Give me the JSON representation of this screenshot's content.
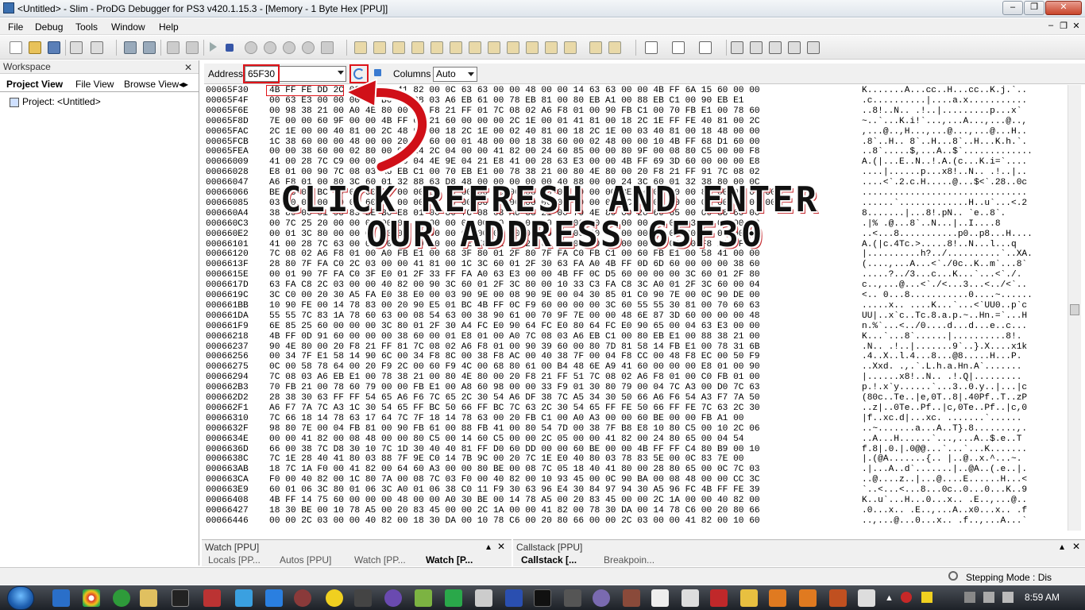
{
  "window": {
    "title": "<Untitled> - Slim - ProDG Debugger for PS3 v420.1.15.3 - [Memory - 1 Byte Hex [PPU]]"
  },
  "menu": [
    "File",
    "Debug",
    "Tools",
    "Window",
    "Help"
  ],
  "workspace": {
    "title": "Workspace",
    "tabs": [
      "Project View",
      "File View",
      "Browse View"
    ],
    "tree_item": "Project: <Untitled>"
  },
  "memory": {
    "address_label": "Address",
    "address_value": "65F30",
    "columns_label": "Columns",
    "columns_value": "Auto",
    "rows": [
      {
        "addr": "00065F30",
        "hex": "4B FF FE DD 2C 03 00 00 41 82 00 0C 63 63 00 00 48 00 00 14 63 63 00 00 4B FF 6A 15 60 00 00",
        "txt": "K.......A...cc..H...cc..K.j.`.."
      },
      {
        "addr": "00065F4F",
        "hex": "00 63 E3 00 00 00 00 B0 7C 08 03 A6 EB 61 00 78 EB 81 00 80 EB A1 00 88 EB C1 00 90 EB E1",
        "txt": ".c..........|....a.x..........."
      },
      {
        "addr": "00065F6E",
        "hex": "00 98 38 21 00 A0 4E 80 00 20 F8 21 FF 01 7C 08 02 A6 F8 01 00 90 FB C1 00 70 FB E1 00 78 60",
        "txt": "..8!..N.. .!..|.........p...x`"
      },
      {
        "addr": "00065F8D",
        "hex": "7E 00 00 60 9F 00 00 4B FF 69 21 60 00 00 00 2C 1E 00 01 41 81 00 18 2C 1E FF FE 40 81 00 2C",
        "txt": "~..`...K.i!`...,...A...,...@..,"
      },
      {
        "addr": "00065FAC",
        "hex": "2C 1E 00 00 40 81 00 2C 48 00 00 18 2C 1E 00 02 40 81 00 18 2C 1E 00 03 40 81 00 18 48 00 00",
        "txt": ",...@..,H...,...@...,...@...H.."
      },
      {
        "addr": "00065FCB",
        "hex": "1C 38 60 00 00 48 00 00 20 38 60 00 01 48 00 00 18 38 60 00 02 48 00 00 10 4B FF 68 D1 60 00",
        "txt": ".8`..H.. 8`..H...8`..H...K.h.`."
      },
      {
        "addr": "00065FEA",
        "hex": "00 00 38 60 00 02 80 00 00 24 2C 04 00 00 41 82 00 24 60 85 00 00 80 9F 00 08 80 C5 00 00 F8",
        "txt": "..8`.....$,...A..$`............."
      },
      {
        "addr": "00066009",
        "hex": "41 00 28 7C C9 00 00 45 00 04 4E 9E 04 21 E8 41 00 28 63 E3 00 00 4B FF 69 3D 60 00 00 00 E8",
        "txt": "A.(|...E..N..!.A.(c...K.i=`...."
      },
      {
        "addr": "00066028",
        "hex": "E8 01 00 90 7C 08 03 A6 EB C1 00 70 EB E1 00 78 38 21 00 80 4E 80 00 20 F8 21 FF 91 7C 08 02",
        "txt": "....|......p...x8!..N.. .!..|.."
      },
      {
        "addr": "00066047",
        "hex": "A6 F8 01 00 80 3C 60 01 32 88 63 D8 48 00 00 00 00 00 40 88 00 00 24 3C 60 01 32 38 80 00 0C",
        "txt": "....<`.2.c.H.....@...$<`.28..0c"
      },
      {
        "addr": "00066066",
        "hex": "BE 88 01 BC 00 00 00 00 00 00 80 00 00 00 00 00 00 00 00 00 00 00 BE A4 00 00 00 88 00 00 00 00",
        "txt": "..............................."
      },
      {
        "addr": "00066085",
        "hex": "03 00 00 00 00 00 60 00 00 00 00 00 00 00 00 00 00 00 00 00 00 00 BC F8 00 00 00 00 00 00 00 00",
        "txt": "......`.............H..u`...<.2"
      },
      {
        "addr": "000660A4",
        "hex": "38 80 00 01 98 83 BE B0 E8 01 00 80 7C 08 03 A6 38 21 00 70 4E 80 00 20 60 65 00 00 38 60 00",
        "txt": "8.......|...8!.pN.. `e..8`."
      },
      {
        "addr": "000660C3",
        "hex": "00 7C 25 20 00 00 00 00 00 00 00 00 00 00 00 60 00 00 00 00 00 00 00 00 7C 08 03 A6 00 00 00",
        "txt": ".|% .@...8`..N...|..I....8"
      },
      {
        "addr": "000660E2",
        "hex": "00 01 3C 80 00 00 00 00 00 00 00 00 00 00 00 00 00 00 00 00 00 00 00 00 00 00 00 00 00 00 00",
        "txt": "..<...8...........p0..p8...H...."
      },
      {
        "addr": "00066101",
        "hex": "41 00 28 7C 63 00 00 00 00 00 00 00 3E E8 41 00 28 63 E3 00 00 48 00 00 80 08 20 F8 21 FF 71",
        "txt": "A.(|c.4Tc.>.....8!..N...l...q"
      },
      {
        "addr": "00066120",
        "hex": "7C 08 02 A6 F8 01 00 A0 FB E1 00 68 3F 80 01 2F 80 7F FA C0 FB C1 00 60 FB E1 00 58 41 00 00",
        "txt": "|..........h?../..........`..XA."
      },
      {
        "addr": "0006613F",
        "hex": "28 80 7F FA C0 2C 03 00 00 41 81 00 1C 3C 60 01 2F 30 63 FA A0 4B FF 0D 6D 60 00 00 00 38 60",
        "txt": "(....,...A...<`./0c..K..m`...8`"
      },
      {
        "addr": "0006615E",
        "hex": "00 01 90 7F FA C0 3F E0 01 2F 33 FF FA A0 63 E3 00 00 4B FF 0C D5 60 00 00 00 3C 60 01 2F 80",
        "txt": ".....?../3...c...K...`...<`./."
      },
      {
        "addr": "0006617D",
        "hex": "63 FA C8 2C 03 00 00 40 82 00 90 3C 60 01 2F 3C 80 00 10 33 C3 FA C8 3C A0 01 2F 3C 60 00 04",
        "txt": "c..,...@...<`./<...3...<../<`.."
      },
      {
        "addr": "0006619C",
        "hex": "3C C0 00 20 30 A5 FA E0 38 E0 00 03 90 9E 00 08 90 9E 00 04 30 85 01 C0 90 7E 00 0C 90 DE 00",
        "txt": "<.. 0...8...........0....~......"
      },
      {
        "addr": "000661BB",
        "hex": "10 90 FE 00 14 78 83 00 20 90 E5 01 BC 4B FF 0C F9 60 00 00 00 3C 60 55 55 30 81 00 70 60 63",
        "txt": ".....x.. ....K...`...<`UU0..p`c"
      },
      {
        "addr": "000661DA",
        "hex": "55 55 7C 83 1A 78 60 63 00 08 54 63 00 38 90 61 00 70 9F 7E 00 00 48 6E 87 3D 60 00 00 00 48",
        "txt": "UU|..x`c..Tc.8.a.p.~..Hn.=`...H"
      },
      {
        "addr": "000661F9",
        "hex": "6E 85 25 60 00 00 00 3C 80 01 2F 30 A4 FC E0 90 64 FC E0 80 64 FC E0 90 65 00 04 63 E3 00 00",
        "txt": "n.%`...<../0....d...d...e..c..."
      },
      {
        "addr": "00066218",
        "hex": "4B FF 0D 91 60 00 00 00 38 60 00 01 E8 01 00 A0 7C 08 03 A6 EB C1 00 80 EB E1 00 88 38 21 00",
        "txt": "K...`...8`......|..........8!."
      },
      {
        "addr": "00066237",
        "hex": "90 4E 80 00 20 F8 21 FF 81 7C 08 02 A6 F8 01 00 90 39 60 00 80 7D 81 58 14 FB E1 00 78 31 6B",
        "txt": ".N.. .!..|.......9`..}.X....x1k"
      },
      {
        "addr": "00066256",
        "hex": "00 34 7F E1 58 14 90 6C 00 34 F8 8C 00 38 F8 AC 00 40 38 7F 00 04 F8 CC 00 48 F8 EC 00 50 F9",
        "txt": ".4..X..l.4...8...@8.....H...P."
      },
      {
        "addr": "00066275",
        "hex": "0C 00 58 78 64 00 20 F9 2C 00 60 F9 4C 00 68 80 61 00 B4 48 6E A9 41 60 00 00 00 E8 01 00 90",
        "txt": "..Xxd. .,.`.L.h.a.Hn.A`......."
      },
      {
        "addr": "00066294",
        "hex": "7C 08 03 A6 EB E1 00 78 38 21 00 80 4E 80 00 20 F8 21 FF 51 7C 08 02 A6 F8 01 00 C0 FB 01 00",
        "txt": "|......x8!..N.. .!.Q|........."
      },
      {
        "addr": "000662B3",
        "hex": "70 FB 21 00 78 60 79 00 00 FB E1 00 A8 60 98 00 00 33 F9 01 30 80 79 00 04 7C A3 00 D0 7C 63",
        "txt": "p.!.x`y......`...3..0.y..|...|c"
      },
      {
        "addr": "000662D2",
        "hex": "28 38 30 63 FF FF 54 65 A6 F6 7C 65 2C 30 54 A6 DF 38 7C A5 34 30 50 66 A6 F6 54 A3 F7 7A 50",
        "txt": "(80c..Te..|e,0T..8|.40Pf..T..zP"
      },
      {
        "addr": "000662F1",
        "hex": "A6 F7 7A 7C A3 1C 30 54 65 FF BC 50 66 FF BC 7C 63 2C 30 54 65 FF FE 50 66 FF FE 7C 63 2C 30",
        "txt": "..z|..0Te..Pf..|c,0Te..Pf..|c,0"
      },
      {
        "addr": "00066310",
        "hex": "7C 66 18 14 78 63 17 64 7C 7F 18 14 78 63 00 20 FB C1 00 A0 A3 00 00 60 BE 00 00 FB A1 00",
        "txt": "|f..xc.d|...xc. .......`......"
      },
      {
        "addr": "0006632F",
        "hex": "98 80 7E 00 04 FB 81 00 90 FB 61 00 88 FB 41 00 80 54 7D 00 38 7F B8 E8 10 80 C5 00 10 2C 06",
        "txt": "..~.......a...A..T}.8........,."
      },
      {
        "addr": "0006634E",
        "hex": "00 00 41 82 00 08 48 00 00 80 C5 00 14 60 C5 00 00 2C 05 00 00 41 82 00 24 80 65 00 04 54",
        "txt": "..A...H......`...,...A..$.e..T"
      },
      {
        "addr": "0006636D",
        "hex": "66 00 38 7C D8 30 10 7C 1D 30 40 40 81 FF D0 60 DD 00 00 60 BE 00 00 4B FF FF C4 80 B9 00 10",
        "txt": "f.8|.0.|.0@@...`...`...K......."
      },
      {
        "addr": "0006638C",
        "hex": "7C 1E 28 40 41 80 03 88 7F 9E C0 14 7B 9C 00 20 7C 1E E0 40 80 03 78 83 5E 00 0C 83 7E 00",
        "txt": "|.(@A.......{.. |..@..x.^...~."
      },
      {
        "addr": "000663AB",
        "hex": "18 7C 1A F0 00 41 82 00 64 60 A3 00 00 80 BE 00 08 7C 05 18 40 41 80 00 28 80 65 00 0C 7C 03",
        "txt": ".|...A..d`.......|..@A..(.e..|."
      },
      {
        "addr": "000663CA",
        "hex": "F0 00 40 82 00 1C 80 7A 00 08 7C 03 F0 00 40 82 00 10 93 45 00 0C 90 BA 00 08 48 00 00 CC 3C",
        "txt": "..@....z..|...@....E......H...<"
      },
      {
        "addr": "000663E9",
        "hex": "60 01 06 3C 80 01 06 3C A0 01 06 38 C0 11 F9 30 63 96 E4 30 84 97 94 30 A5 96 FC 4B FF FE 39",
        "txt": "`..<...<...8...0c..0...0...K..9"
      },
      {
        "addr": "00066408",
        "hex": "4B FF 14 75 60 00 00 00 48 00 00 A0 30 BE 00 14 78 A5 00 20 83 45 00 00 2C 1A 00 00 40 82 00",
        "txt": "K..u`...H...0...x.. .E..,...@.."
      },
      {
        "addr": "00066427",
        "hex": "18 30 BE 00 10 78 A5 00 20 83 45 00 00 2C 1A 00 00 41 82 00 78 30 DA 00 14 78 C6 00 20 80 66",
        "txt": ".0...x.. .E..,...A..x0...x.. .f"
      },
      {
        "addr": "00066446",
        "hex": "00 00 2C 03 00 00 40 82 00 18 30 DA 00 10 78 C6 00 20 80 66 00 00 2C 03 00 00 41 82 00 10 60",
        "txt": "..,...@...0...x.. .f..,...A...`"
      }
    ]
  },
  "overlay_text": {
    "line1": "CLICK REFRESH AND ENTER",
    "line2": "OUR ADDRESS 65F30"
  },
  "watch_panel": {
    "title": "Watch [PPU]",
    "tabs": [
      "Locals [PP...",
      "Autos [PPU]",
      "Watch [PP...",
      "Watch [P..."
    ]
  },
  "callstack_panel": {
    "title": "Callstack [PPU]",
    "tabs": [
      "Callstack [...",
      "Breakpoin..."
    ]
  },
  "status": {
    "stepping": "Stepping Mode : Dis"
  },
  "taskbar": {
    "clock": "8:59 AM"
  },
  "colors": {
    "highlight": "#e0141a",
    "arrow": "#d01018"
  }
}
